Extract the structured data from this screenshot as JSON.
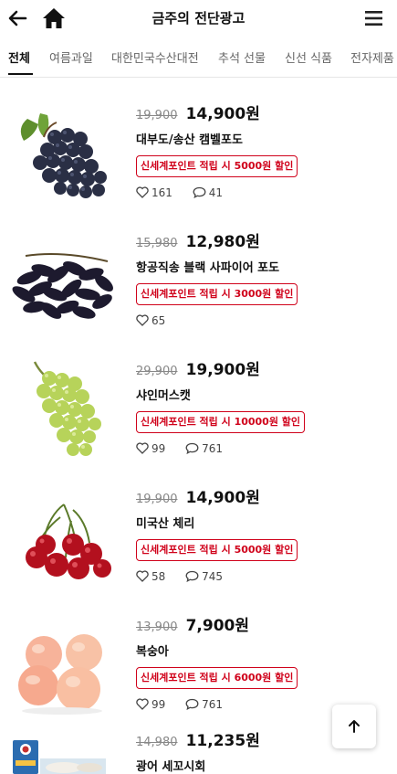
{
  "header": {
    "title": "금주의 전단광고",
    "back_icon": "arrow-left-icon",
    "home_icon": "home-icon",
    "menu_icon": "hamburger-menu-icon"
  },
  "tabs": [
    "전체",
    "여름과일",
    "대한민국수산대전",
    "추석 선물",
    "신선 식품",
    "전자제품"
  ],
  "active_tab": "전체",
  "products": [
    {
      "old_price": "19,900",
      "price": "14,900원",
      "name": "대부도/송산 캠벨포도",
      "badge": "신세계포인트 적립 시 5000원 할인",
      "likes": "161",
      "comments": "41",
      "image": "black-grapes"
    },
    {
      "old_price": "15,980",
      "price": "12,980원",
      "name": "항공직송 블랙 사파이어 포도",
      "badge": "신세계포인트 적립 시 3000원 할인",
      "likes": "65",
      "comments": "",
      "image": "sapphire-grapes"
    },
    {
      "old_price": "29,900",
      "price": "19,900원",
      "name": "샤인머스캣",
      "badge": "신세계포인트 적립 시 10000원 할인",
      "likes": "99",
      "comments": "761",
      "image": "shine-muscat"
    },
    {
      "old_price": "19,900",
      "price": "14,900원",
      "name": "미국산 체리",
      "badge": "신세계포인트 적립 시 5000원 할인",
      "likes": "58",
      "comments": "745",
      "image": "cherries"
    },
    {
      "old_price": "13,900",
      "price": "7,900원",
      "name": "복숭아",
      "badge": "신세계포인트 적립 시 6000원 할인",
      "likes": "99",
      "comments": "761",
      "image": "peaches"
    },
    {
      "old_price": "14,980",
      "price": "11,235원",
      "name": "광어 세꼬시회",
      "badge": "",
      "likes": "",
      "comments": "",
      "image": "flatfish-sashimi"
    }
  ],
  "scroll_top_icon": "arrow-up-icon",
  "colors": {
    "accent_red": "#d0021b",
    "text": "#111111",
    "muted": "#888888"
  }
}
